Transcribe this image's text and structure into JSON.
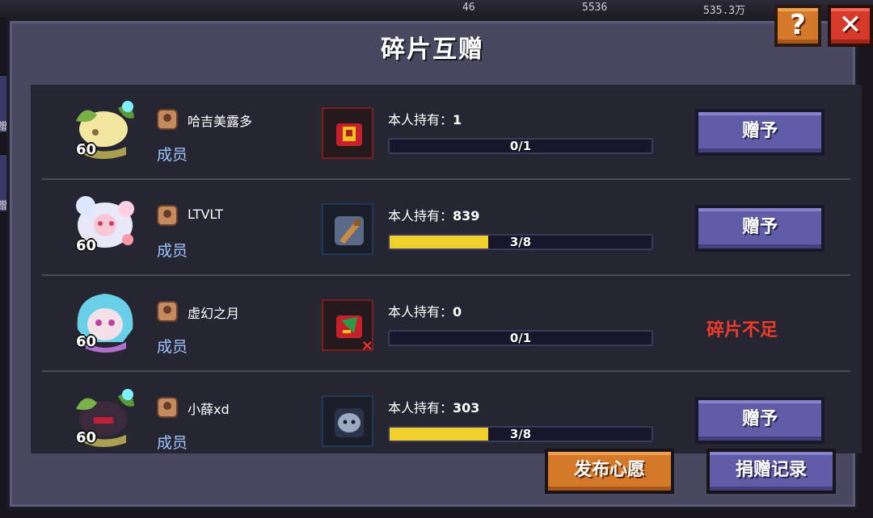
{
  "topbar": {
    "resources": [
      {
        "icon": "gem-icon",
        "value": "46"
      },
      {
        "icon": "crystal-icon",
        "value": "5536"
      },
      {
        "icon": "gold-icon",
        "value": "535.3万"
      }
    ]
  },
  "side_tabs": [
    "赠",
    "赠"
  ],
  "dialog": {
    "title": "碎片互赠",
    "help_label": "?",
    "close_label": "✕"
  },
  "rows": [
    {
      "name": "哈吉美露多",
      "role": "成员",
      "level": "60",
      "held_label": "本人持有：",
      "held_value": "1",
      "progress_text": "0/1",
      "progress": 0.0,
      "action": "赠予",
      "avatar": "yellow-plant-avatar",
      "item_icon": "red-gold-shard-icon",
      "item_frame": "red"
    },
    {
      "name": "LTVLT",
      "role": "成员",
      "level": "60",
      "held_label": "本人持有：",
      "held_value": "839",
      "progress_text": "3/8",
      "progress": 0.375,
      "action": "赠予",
      "avatar": "white-bunny-avatar",
      "item_icon": "blue-rod-shard-icon",
      "item_frame": "blue"
    },
    {
      "name": "虚幻之月",
      "role": "成员",
      "level": "60",
      "held_label": "本人持有：",
      "held_value": "0",
      "progress_text": "0/1",
      "progress": 0.0,
      "action": "碎片不足",
      "avatar": "cyan-hair-girl-avatar",
      "item_icon": "red-green-shard-icon",
      "item_frame": "red"
    },
    {
      "name": "小薛xd",
      "role": "成员",
      "level": "60",
      "held_label": "本人持有：",
      "held_value": "303",
      "progress_text": "3/8",
      "progress": 0.375,
      "action": "赠予",
      "avatar": "dark-plant-avatar",
      "item_icon": "blue-blob-shard-icon",
      "item_frame": "blue"
    }
  ],
  "footer": {
    "wish_label": "发布心愿",
    "record_label": "捐赠记录"
  },
  "colors": {
    "panel": "#484860",
    "list_bg": "#262632",
    "orange_button": "#d4792a",
    "purple_button": "#605ca8",
    "close_button": "#d83a2a",
    "progress_fill": "#f0d02c",
    "role_text": "#9ec4ff",
    "insufficient_text": "#f03a2a"
  }
}
